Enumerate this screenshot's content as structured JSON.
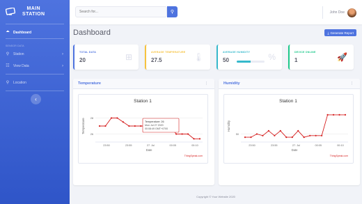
{
  "app": {
    "brand_line1": "MAIN",
    "brand_line2": "STATION"
  },
  "sidebar": {
    "items": [
      {
        "label": "Dashboard",
        "icon": "dashboard-icon",
        "glyph": "⏶"
      },
      {
        "label": "Station",
        "icon": "station-icon",
        "glyph": "⚲"
      },
      {
        "label": "View Data",
        "icon": "table-icon",
        "glyph": "☷"
      },
      {
        "label": "Location",
        "icon": "map-marker-icon",
        "glyph": "⚲"
      }
    ],
    "heading": "SENSOR DATA",
    "toggle_glyph": "‹"
  },
  "topbar": {
    "search_placeholder": "Search for...",
    "search_glyph": "⚲",
    "user_name": "John Doe"
  },
  "page": {
    "title": "Dashboard",
    "report_button": "Generate Report",
    "report_glyph": "⤓"
  },
  "stats": [
    {
      "label": "TOTAL DATA",
      "value": "20",
      "color": "#4e73df",
      "icon": "table-icon",
      "glyph": "⊞"
    },
    {
      "label": "AVERAGE TEMPERATURE",
      "value": "27.5",
      "color": "#f6c23e",
      "icon": "thermometer-icon",
      "glyph": "🌡"
    },
    {
      "label": "AVERAGE HUMIDITY",
      "value": "50",
      "color": "#36b9cc",
      "icon": "percent-icon",
      "glyph": "%",
      "progress": 0.5
    },
    {
      "label": "DEVICE ONLINE",
      "value": "1",
      "color": "#1cc88a",
      "icon": "rocket-icon",
      "glyph": "🚀"
    }
  ],
  "panels": {
    "temperature": "Temperature",
    "humidity": "Humidity",
    "menu_glyph": "⋮"
  },
  "footer": "Copyright © Your Website 2020",
  "chart_data": [
    {
      "type": "line",
      "title": "Station 1",
      "xlabel": "Date",
      "ylabel": "Temperature",
      "x": [
        "23:50",
        "23:55",
        "27. Jul",
        "00:05",
        "00:10"
      ],
      "ylim": [
        25,
        29
      ],
      "yticks": [
        26,
        28
      ],
      "series": [
        {
          "values": [
            27,
            27,
            28,
            28,
            27.5,
            27,
            27,
            27,
            27,
            27,
            27,
            27,
            27,
            26,
            26,
            26,
            25.4,
            25.4
          ]
        }
      ],
      "tooltip": {
        "title": "Temperature: 26",
        "line1": "Mon Jul 27 2020",
        "line2": "00:08:49 GMT+0700"
      },
      "credits": "ThingSpeak.com",
      "color": "#d62020"
    },
    {
      "type": "line",
      "title": "Station 1",
      "xlabel": "Date",
      "ylabel": "Humidity",
      "x": [
        "23:50",
        "23:55",
        "27. Jul",
        "00:05",
        "00:10"
      ],
      "ylim": [
        45,
        65
      ],
      "yticks": [
        50
      ],
      "series": [
        {
          "values": [
            48,
            48,
            50,
            49,
            52,
            49,
            52,
            48,
            48,
            52,
            48,
            49,
            49,
            49,
            62,
            62,
            62,
            62
          ]
        }
      ],
      "credits": "ThingSpeak.com",
      "color": "#d62020"
    }
  ]
}
